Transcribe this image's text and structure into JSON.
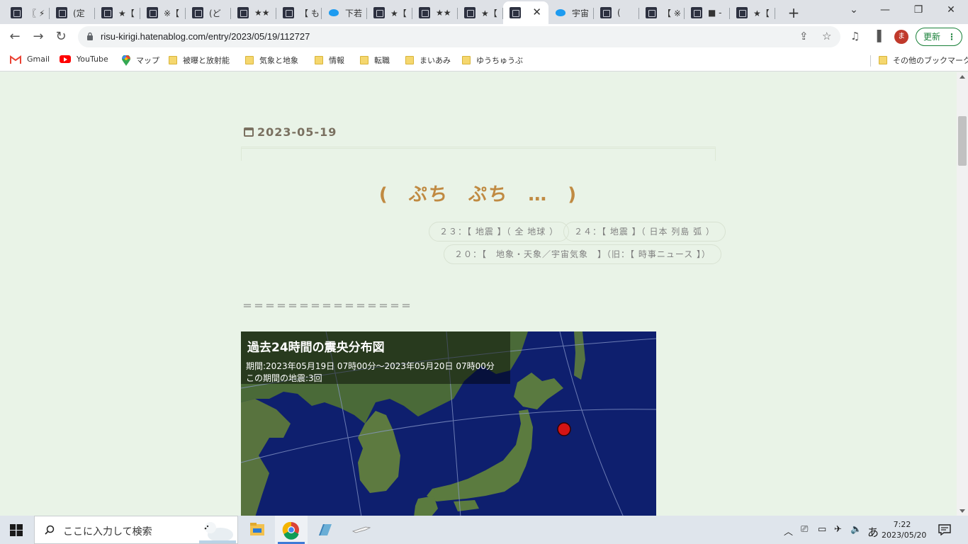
{
  "browser": {
    "tabs": [
      {
        "title": "〖 ⚡",
        "icon": "blog-favicon-icon"
      },
      {
        "title": "(定",
        "icon": "blog-favicon-icon"
      },
      {
        "title": "★【",
        "icon": "blog-favicon-icon"
      },
      {
        "title": "※【",
        "icon": "blog-favicon-icon"
      },
      {
        "title": "(ど",
        "icon": "blog-favicon-icon"
      },
      {
        "title": "★★",
        "icon": "blog-favicon-icon"
      },
      {
        "title": "【 も",
        "icon": "blog-favicon-icon"
      },
      {
        "title": "下若",
        "icon": "twitter-icon"
      },
      {
        "title": "★【",
        "icon": "blog-favicon-icon"
      },
      {
        "title": "★★",
        "icon": "blog-favicon-icon"
      },
      {
        "title": "★【",
        "icon": "blog-favicon-icon"
      },
      {
        "title": "",
        "icon": "blog-favicon-icon",
        "active": true
      },
      {
        "title": "宇宙",
        "icon": "twitter-icon"
      },
      {
        "title": "(",
        "icon": "blog-favicon-icon"
      },
      {
        "title": "【 ※",
        "icon": "blog-favicon-icon"
      },
      {
        "title": "■ -",
        "icon": "blog-favicon-icon"
      },
      {
        "title": "★【",
        "icon": "blog-favicon-icon"
      }
    ],
    "url": "risu-kirigi.hatenablog.com/entry/2023/05/19/112727",
    "profile_initial": "ま",
    "update_label": "更新",
    "bookmarks": [
      {
        "label": "Gmail",
        "icon": "gmail-icon"
      },
      {
        "label": "YouTube",
        "icon": "youtube-icon"
      },
      {
        "label": "マップ",
        "icon": "maps-icon"
      },
      {
        "label": "被曝と放射能",
        "icon": "folder-icon"
      },
      {
        "label": "気象と地象",
        "icon": "folder-icon"
      },
      {
        "label": "情報",
        "icon": "folder-icon"
      },
      {
        "label": "転職",
        "icon": "folder-icon"
      },
      {
        "label": "まいあみ",
        "icon": "folder-icon"
      },
      {
        "label": "ゆうちゅうぶ",
        "icon": "folder-icon"
      }
    ],
    "other_bookmarks": "その他のブックマーク"
  },
  "article": {
    "date": "2023-05-19",
    "title": "(　ぷち　ぷち　…　)",
    "categories": [
      "２３：【 地震 】（ 全 地球 ）",
      "２４：【 地震 】（ 日本 列島 弧 ）",
      "２０：【　地象・天象／宇宙気象　】（旧：【 時事ニュース 】）"
    ],
    "separator": "＝＝＝＝＝＝＝＝＝＝＝＝＝＝＝",
    "map": {
      "title": "過去24時間の震央分布図",
      "period": "期間:2023年05月19日 07時00分～2023年05月20日 07時00分",
      "count": "この期間の地震:3回"
    }
  },
  "taskbar": {
    "search_placeholder": "ここに入力して検索",
    "ime": "あ",
    "time": "7:22",
    "date": "2023/05/20"
  }
}
